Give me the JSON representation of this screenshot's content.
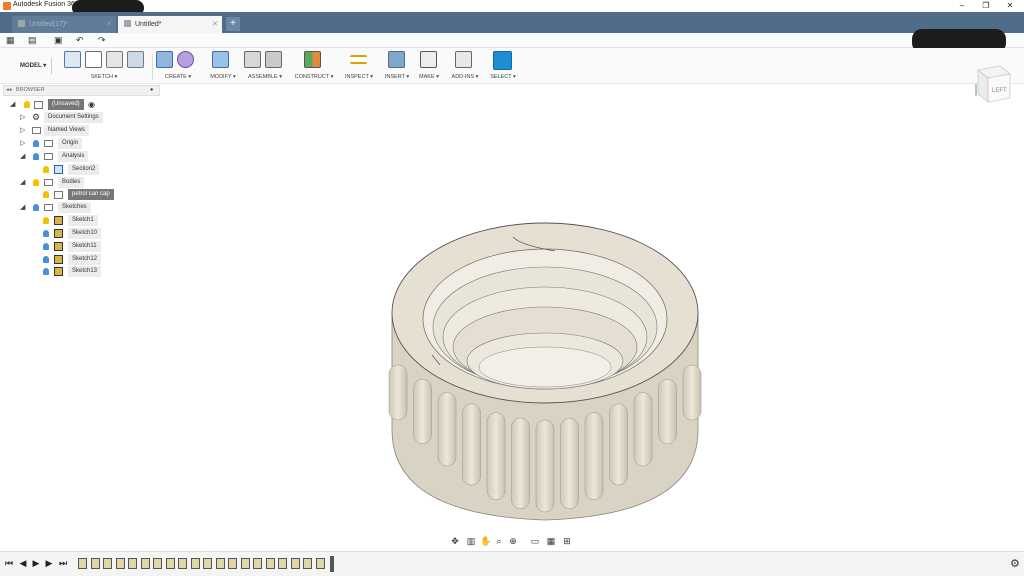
{
  "window": {
    "title": "Autodesk Fusion 360",
    "controls": [
      "–",
      "❐",
      "✕"
    ]
  },
  "tabs": [
    {
      "label": "Untitled(17)*",
      "active": false
    },
    {
      "label": "Untitled*",
      "active": true
    }
  ],
  "ribbon": {
    "workspace": "MODEL",
    "groups": [
      "SKETCH",
      "CREATE",
      "MODIFY",
      "ASSEMBLE",
      "CONSTRUCT",
      "INSPECT",
      "INSERT",
      "MAKE",
      "ADD-INS",
      "SELECT"
    ]
  },
  "browser": {
    "title": "BROWSER",
    "root": "(Unsaved)",
    "items": [
      {
        "label": "Document Settings"
      },
      {
        "label": "Named Views"
      },
      {
        "label": "Origin"
      },
      {
        "label": "Analysis"
      },
      {
        "label": "Section2"
      },
      {
        "label": "Bodies"
      },
      {
        "label": "petrol can cap"
      },
      {
        "label": "Sketches"
      },
      {
        "label": "Sketch1"
      },
      {
        "label": "Sketch10"
      },
      {
        "label": "Sketch11"
      },
      {
        "label": "Sketch12"
      },
      {
        "label": "Sketch13"
      }
    ]
  },
  "viewcube": {
    "face": "LEFT"
  },
  "colors": {
    "accent": "#1b8fd1",
    "tabbar": "#4f6d89",
    "body": "#e6e0d2"
  }
}
